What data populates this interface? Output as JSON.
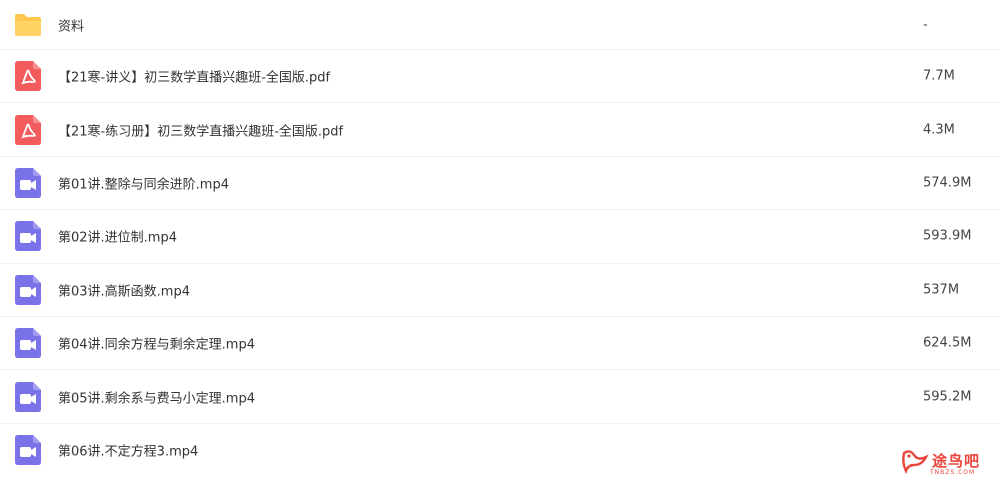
{
  "files": [
    {
      "name": "资料",
      "size": "-",
      "icon": "folder-icon",
      "color": "#ffc74d"
    },
    {
      "name": "【21寒-讲义】初三数学直播兴趣班-全国版.pdf",
      "size": "7.7M",
      "icon": "pdf-icon",
      "color": "#f25c5c"
    },
    {
      "name": "【21寒-练习册】初三数学直播兴趣班-全国版.pdf",
      "size": "4.3M",
      "icon": "pdf-icon",
      "color": "#f25c5c"
    },
    {
      "name": "第01讲.整除与同余进阶.mp4",
      "size": "574.9M",
      "icon": "video-icon",
      "color": "#7a72e8"
    },
    {
      "name": "第02讲.进位制.mp4",
      "size": "593.9M",
      "icon": "video-icon",
      "color": "#7a72e8"
    },
    {
      "name": "第03讲.高斯函数.mp4",
      "size": "537M",
      "icon": "video-icon",
      "color": "#7a72e8"
    },
    {
      "name": "第04讲.同余方程与剩余定理.mp4",
      "size": "624.5M",
      "icon": "video-icon",
      "color": "#7a72e8"
    },
    {
      "name": "第05讲.剩余系与费马小定理.mp4",
      "size": "595.2M",
      "icon": "video-icon",
      "color": "#7a72e8"
    },
    {
      "name": "第06讲.不定方程3.mp4",
      "size": "",
      "icon": "video-icon",
      "color": "#7a72e8"
    }
  ],
  "watermark": {
    "text": "途鸟吧",
    "sub": "TNBZS.COM",
    "color": "#e8453c"
  }
}
